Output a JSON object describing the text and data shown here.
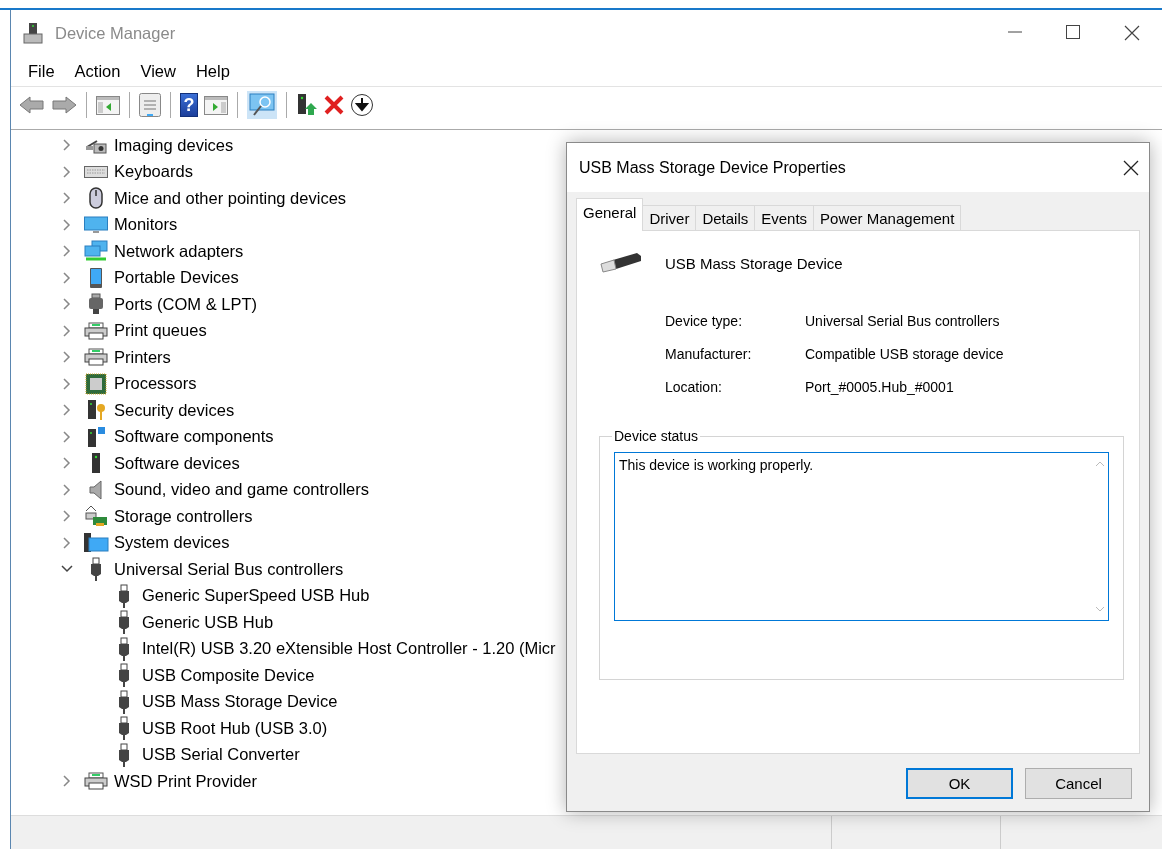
{
  "window": {
    "title": "Device Manager"
  },
  "menu": [
    "File",
    "Action",
    "View",
    "Help"
  ],
  "toolbar": [
    {
      "kind": "back"
    },
    {
      "kind": "forward"
    },
    {
      "kind": "sep"
    },
    {
      "kind": "tree"
    },
    {
      "kind": "sep"
    },
    {
      "kind": "properties"
    },
    {
      "kind": "sep"
    },
    {
      "kind": "help",
      "glyph": "?"
    },
    {
      "kind": "pane"
    },
    {
      "kind": "sep"
    },
    {
      "kind": "scan"
    },
    {
      "kind": "sep"
    },
    {
      "kind": "update"
    },
    {
      "kind": "uninstall"
    },
    {
      "kind": "disable"
    }
  ],
  "tree": [
    {
      "label": "Imaging devices",
      "expanded": false
    },
    {
      "label": "Keyboards",
      "expanded": false
    },
    {
      "label": "Mice and other pointing devices",
      "expanded": false
    },
    {
      "label": "Monitors",
      "expanded": false
    },
    {
      "label": "Network adapters",
      "expanded": false
    },
    {
      "label": "Portable Devices",
      "expanded": false
    },
    {
      "label": "Ports (COM & LPT)",
      "expanded": false
    },
    {
      "label": "Print queues",
      "expanded": false
    },
    {
      "label": "Printers",
      "expanded": false
    },
    {
      "label": "Processors",
      "expanded": false
    },
    {
      "label": "Security devices",
      "expanded": false
    },
    {
      "label": "Software components",
      "expanded": false
    },
    {
      "label": "Software devices",
      "expanded": false
    },
    {
      "label": "Sound, video and game controllers",
      "expanded": false
    },
    {
      "label": "Storage controllers",
      "expanded": false
    },
    {
      "label": "System devices",
      "expanded": false
    },
    {
      "label": "Universal Serial Bus controllers",
      "expanded": true,
      "children": [
        {
          "label": "Generic SuperSpeed USB Hub"
        },
        {
          "label": "Generic USB Hub"
        },
        {
          "label": "Intel(R) USB 3.20 eXtensible Host Controller - 1.20 (Micr"
        },
        {
          "label": "USB Composite Device"
        },
        {
          "label": "USB Mass Storage Device"
        },
        {
          "label": "USB Root Hub (USB 3.0)"
        },
        {
          "label": "USB Serial Converter"
        }
      ]
    },
    {
      "label": "WSD Print Provider",
      "expanded": false
    }
  ],
  "dialog": {
    "title": "USB Mass Storage Device Properties",
    "tabs": [
      {
        "label": "General",
        "selected": true
      },
      {
        "label": "Driver",
        "selected": false
      },
      {
        "label": "Details",
        "selected": false
      },
      {
        "label": "Events",
        "selected": false
      },
      {
        "label": "Power Management",
        "selected": false
      }
    ],
    "device_name": "USB Mass Storage Device",
    "properties": [
      {
        "label": "Device type:",
        "value": "Universal Serial Bus controllers"
      },
      {
        "label": "Manufacturer:",
        "value": "Compatible USB storage device"
      },
      {
        "label": "Location:",
        "value": "Port_#0005.Hub_#0001"
      }
    ],
    "status_group": "Device status",
    "status_text": "This device is working properly.",
    "buttons": [
      {
        "label": "OK",
        "default": true
      },
      {
        "label": "Cancel",
        "default": false
      }
    ]
  }
}
